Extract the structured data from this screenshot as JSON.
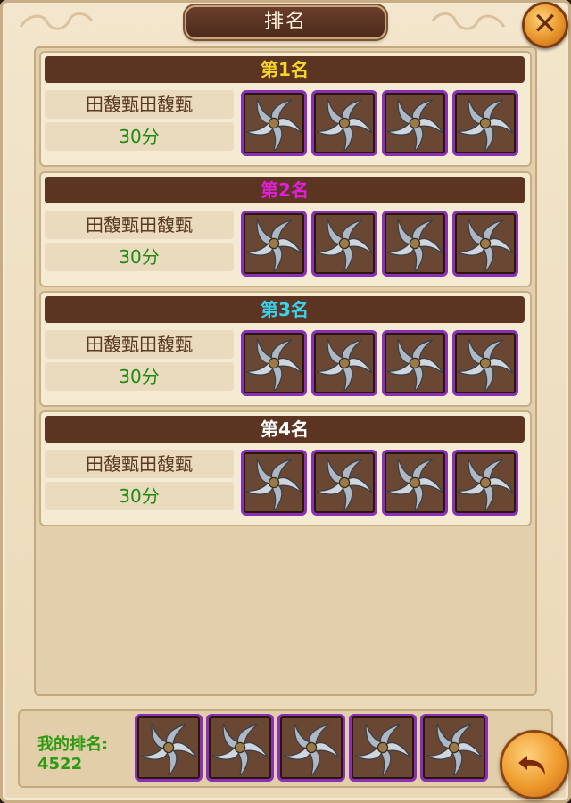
{
  "dialog": {
    "title": "排名",
    "close_icon": "close-icon",
    "back_icon": "return-arrow-icon"
  },
  "colors": {
    "rank1": "#f7d62a",
    "rank2": "#e21fd8",
    "rank3": "#39d3ef",
    "rank4": "#ffffff",
    "score": "#1f8a12",
    "slot_border": "#8a2fb8"
  },
  "ranks": [
    {
      "label": "第1名",
      "player": "田馥甄田馥甄",
      "score": "30分",
      "rewards": [
        "shuriken-icon",
        "shuriken-icon",
        "shuriken-icon",
        "shuriken-icon"
      ]
    },
    {
      "label": "第2名",
      "player": "田馥甄田馥甄",
      "score": "30分",
      "rewards": [
        "shuriken-icon",
        "shuriken-icon",
        "shuriken-icon",
        "shuriken-icon"
      ]
    },
    {
      "label": "第3名",
      "player": "田馥甄田馥甄",
      "score": "30分",
      "rewards": [
        "shuriken-icon",
        "shuriken-icon",
        "shuriken-icon",
        "shuriken-icon"
      ]
    },
    {
      "label": "第4名",
      "player": "田馥甄田馥甄",
      "score": "30分",
      "rewards": [
        "shuriken-icon",
        "shuriken-icon",
        "shuriken-icon",
        "shuriken-icon"
      ]
    }
  ],
  "my_rank": {
    "label": "我的排名:",
    "value": "4522",
    "rewards": [
      "shuriken-icon",
      "shuriken-icon",
      "shuriken-icon",
      "shuriken-icon",
      "shuriken-icon"
    ]
  }
}
